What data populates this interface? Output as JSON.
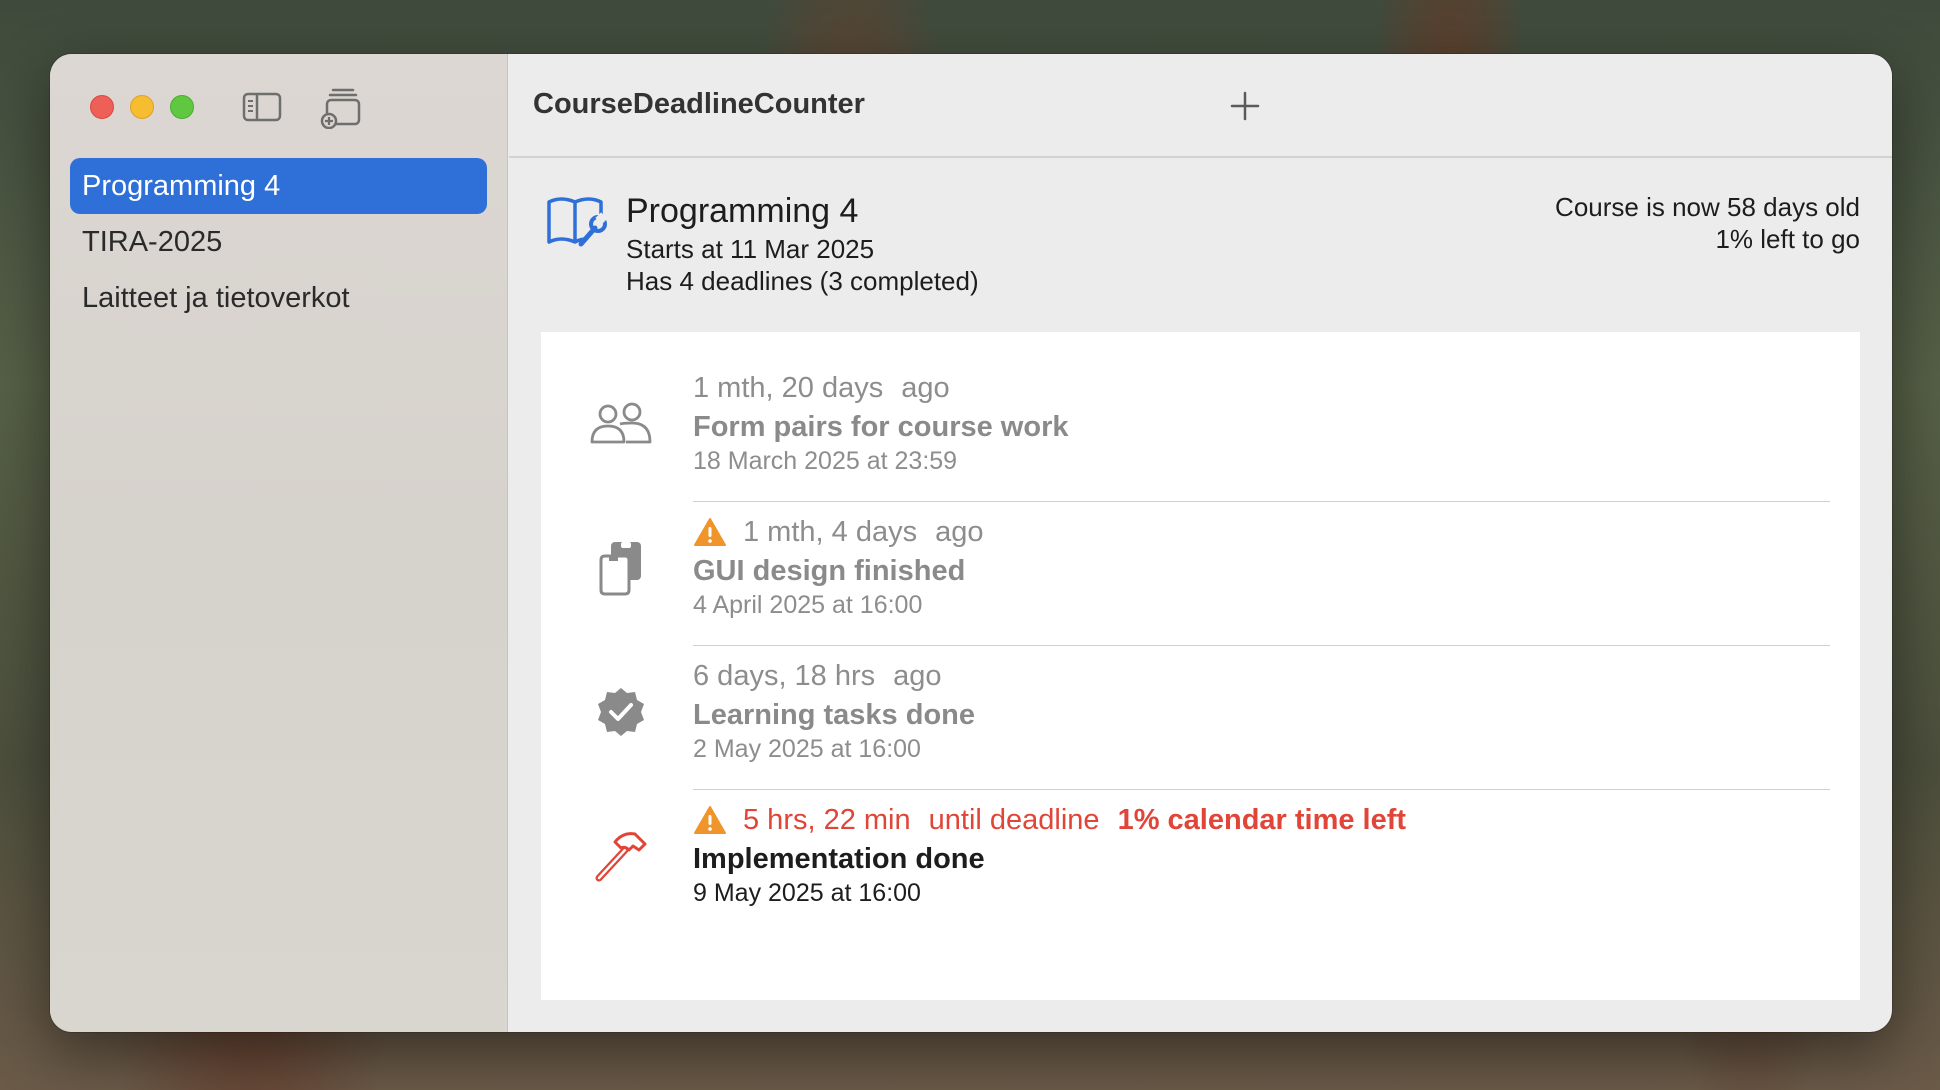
{
  "app": {
    "title": "CourseDeadlineCounter"
  },
  "sidebar": {
    "items": [
      {
        "label": "Programming 4"
      },
      {
        "label": "TIRA-2025"
      },
      {
        "label": "Laitteet ja tietoverkot"
      }
    ]
  },
  "course": {
    "icon": "book-wrench-icon",
    "name": "Programming 4",
    "starts": "Starts at 11 Mar 2025",
    "deadlines": "Has 4 deadlines (3 completed)",
    "age": "Course is now 58 days old",
    "left": "1% left to go"
  },
  "deadlines": [
    {
      "icon": "people-icon",
      "warning": false,
      "time": "1 mth, 20 days",
      "suffix": "ago",
      "extra": "",
      "title": "Form pairs for course work",
      "date": "18 March 2025 at 23:59"
    },
    {
      "icon": "documents-icon",
      "warning": true,
      "time": "1 mth, 4 days",
      "suffix": "ago",
      "extra": "",
      "title": "GUI design finished",
      "date": "4 April 2025 at 16:00"
    },
    {
      "icon": "checkmark-seal-icon",
      "warning": false,
      "time": "6 days, 18 hrs",
      "suffix": "ago",
      "extra": "",
      "title": "Learning tasks done",
      "date": "2 May 2025 at 16:00"
    },
    {
      "icon": "hammer-icon",
      "warning": true,
      "time": "5 hrs, 22 min",
      "suffix": "until deadline",
      "extra": "1% calendar time left",
      "title": "Implementation done",
      "date": "9 May 2025 at 16:00"
    }
  ],
  "colors": {
    "accent": "#2f6fd8",
    "urgent": "#e14537",
    "warning": "#f0952b",
    "muted": "#8d8d8d"
  }
}
